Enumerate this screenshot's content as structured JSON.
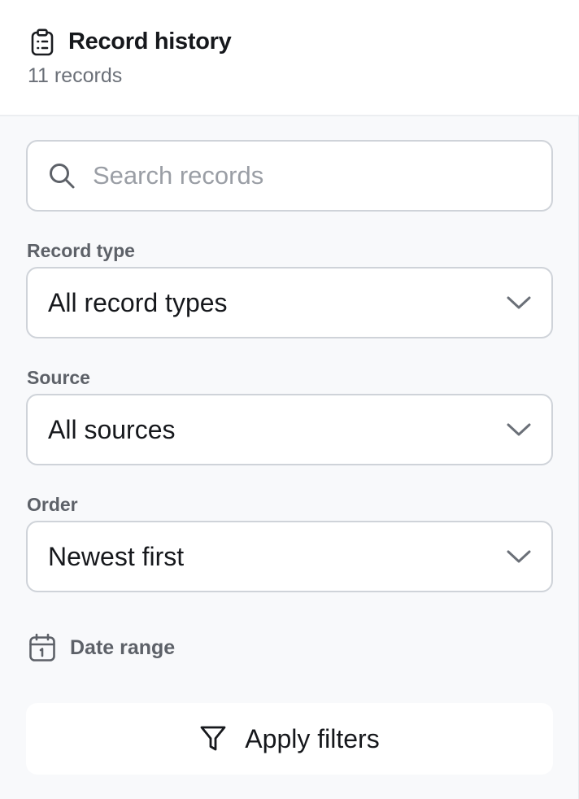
{
  "header": {
    "icon": "clipboard-list-icon",
    "title": "Record history",
    "count_text": "11 records"
  },
  "search": {
    "icon": "search-icon",
    "placeholder": "Search records",
    "value": ""
  },
  "filters": {
    "record_type": {
      "label": "Record type",
      "selected": "All record types",
      "icon": "chevron-down-icon"
    },
    "source": {
      "label": "Source",
      "selected": "All sources",
      "icon": "chevron-down-icon"
    },
    "order": {
      "label": "Order",
      "selected": "Newest first",
      "icon": "chevron-down-icon"
    },
    "date_range": {
      "icon": "calendar-icon",
      "label": "Date range"
    }
  },
  "apply_button": {
    "icon": "funnel-icon",
    "label": "Apply filters"
  },
  "colors": {
    "panel_background": "#f8f9fb",
    "header_background": "#ffffff",
    "border": "#cfd3d9",
    "text_primary": "#16181c",
    "text_secondary": "#6b7078",
    "label_text": "#5d6168",
    "placeholder_text": "#9a9ea5"
  }
}
